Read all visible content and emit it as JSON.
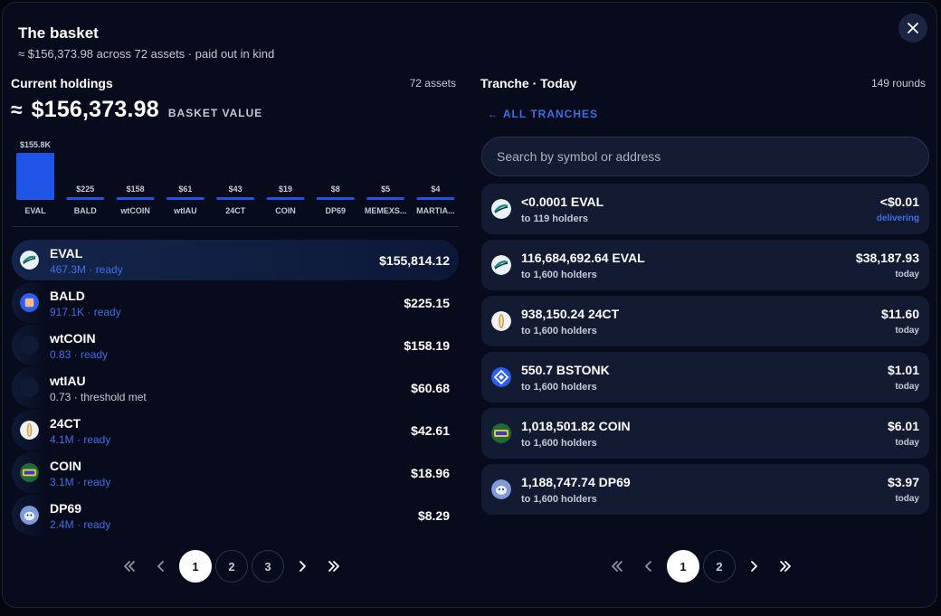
{
  "modal": {
    "title": "The basket",
    "subtitle": "≈ $156,373.98 across 72 assets · paid out in kind"
  },
  "holdings": {
    "title": "Current holdings",
    "count": "72 assets",
    "approx": "≈",
    "total": "$156,373.98",
    "total_label": "BASKET VALUE",
    "rows": [
      {
        "symbol": "EVAL",
        "sub": "467.3M · ready",
        "value": "$155,814.12",
        "icon": "eval-token-icon"
      },
      {
        "symbol": "BALD",
        "sub": "917.1K · ready",
        "value": "$225.15",
        "icon": "bald-token-icon"
      },
      {
        "symbol": "wtCOIN",
        "sub": "0.83 · ready",
        "value": "$158.19",
        "icon": "wtcoin-token-icon"
      },
      {
        "symbol": "wtIAU",
        "sub": "0.73 · threshold met",
        "value": "$60.68",
        "icon": "wtiau-token-icon"
      },
      {
        "symbol": "24CT",
        "sub": "4.1M · ready",
        "value": "$42.61",
        "icon": "24ct-token-icon"
      },
      {
        "symbol": "COIN",
        "sub": "3.1M · ready",
        "value": "$18.96",
        "icon": "coin-token-icon"
      },
      {
        "symbol": "DP69",
        "sub": "2.4M · ready",
        "value": "$8.29",
        "icon": "dp69-token-icon"
      }
    ],
    "pager": {
      "pages": [
        "1",
        "2",
        "3"
      ],
      "current": "1"
    }
  },
  "chart_data": {
    "type": "bar",
    "categories": [
      "EVAL",
      "BALD",
      "wtCOIN",
      "wtIAU",
      "24CT",
      "COIN",
      "DP69",
      "MEMEXS...",
      "MARTIA..."
    ],
    "values": [
      155800,
      225,
      158,
      61,
      43,
      19,
      8,
      5,
      4
    ],
    "value_labels": [
      "$155.8K",
      "$225",
      "$158",
      "$61",
      "$43",
      "$19",
      "$8",
      "$5",
      "$4"
    ],
    "colors": {
      "bar": "#1f55e6"
    }
  },
  "tranche": {
    "title": "Tranche · Today",
    "count": "149 rounds",
    "back_label": "← ALL TRANCHES",
    "search_placeholder": "Search by symbol or address",
    "cards": [
      {
        "amount": "<0.0001 EVAL",
        "holders": "to 119 holders",
        "value": "<$0.01",
        "status": "delivering",
        "icon": "eval-token-icon"
      },
      {
        "amount": "116,684,692.64 EVAL",
        "holders": "to 1,600 holders",
        "value": "$38,187.93",
        "status": "today",
        "icon": "eval-token-icon"
      },
      {
        "amount": "938,150.24 24CT",
        "holders": "to 1,600 holders",
        "value": "$11.60",
        "status": "today",
        "icon": "24ct-token-icon"
      },
      {
        "amount": "550.7 BSTONK",
        "holders": "to 1,600 holders",
        "value": "$1.01",
        "status": "today",
        "icon": "bstonk-token-icon"
      },
      {
        "amount": "1,018,501.82 COIN",
        "holders": "to 1,600 holders",
        "value": "$6.01",
        "status": "today",
        "icon": "coin-token-icon"
      },
      {
        "amount": "1,188,747.74 DP69",
        "holders": "to 1,600 holders",
        "value": "$3.97",
        "status": "today",
        "icon": "dp69-token-icon"
      }
    ],
    "pager": {
      "pages": [
        "1",
        "2"
      ],
      "current": "1"
    }
  },
  "colors": {
    "accent": "#3f6ee6",
    "panel": "#070b1c",
    "card": "#131b33"
  }
}
